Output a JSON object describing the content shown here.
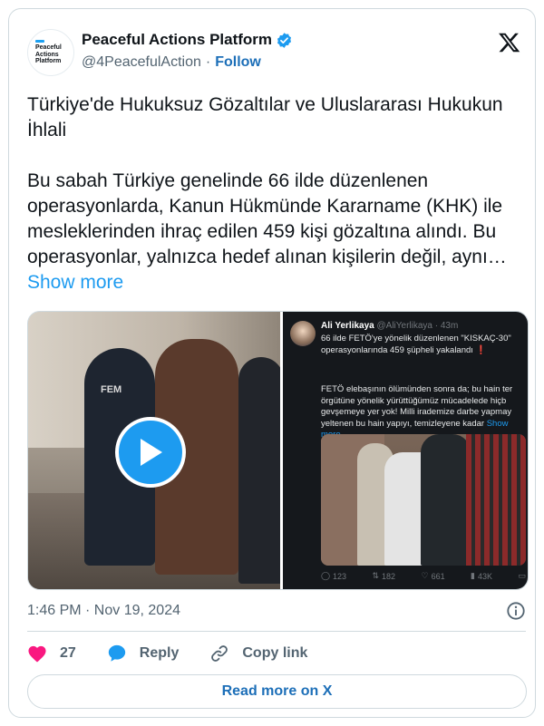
{
  "author": {
    "display_name": "Peaceful Actions Platform",
    "handle": "@4PeacefulAction",
    "separator": "·",
    "follow_label": "Follow",
    "avatar_text": [
      "Peaceful",
      "Actions",
      "Platform"
    ]
  },
  "tweet": {
    "text": "Türkiye'de Hukuksuz Gözaltılar ve Uluslararası Hukukun İhlali\n\nBu sabah Türkiye genelinde 66 ilde düzenlenen operasyonlarda, Kanun Hükmünde Kararname (KHK) ile mesleklerinden ihraç edilen 459 kişi gözaltına alındı. Bu operasyonlar, yalnızca hedef alınan kişilerin değil, aynı… ",
    "show_more": "Show more",
    "timestamp": "1:46 PM · Nov 19, 2024"
  },
  "media": {
    "video_vest_text": "FEM",
    "retweet": {
      "name": "Ali Yerlikaya",
      "handle_time": "@AliYerlikaya · 43m",
      "text1": "66 ilde FETÖ'ye yönelik düzenlenen \"KISKAÇ-30\" operasyonlarında 459 şüpheli yakalandı ❗",
      "text2": "FETÖ elebaşının ölümünden sonra da; bu hain ter örgütüne yönelik yürüttüğümüz mücadelede hiçb gevşemeye yer yok! Milli irademize darbe yapmay yeltenen bu hain yapıyı, temizleyene kadar ",
      "more": "Show more",
      "stats": {
        "replies": "123",
        "reposts": "182",
        "likes": "661",
        "views": "43K"
      }
    }
  },
  "actions": {
    "like_count": "27",
    "reply_label": "Reply",
    "copy_link_label": "Copy link"
  },
  "read_more_label": "Read more on X",
  "colors": {
    "accent": "#1d9bf0",
    "link": "#1d6fb8",
    "heart": "#f91880",
    "muted": "#536471",
    "border": "#cfd9de"
  },
  "icons": [
    "verified-badge-icon",
    "x-logo-icon",
    "play-icon",
    "info-icon",
    "heart-icon",
    "reply-bubble-icon",
    "link-icon"
  ]
}
